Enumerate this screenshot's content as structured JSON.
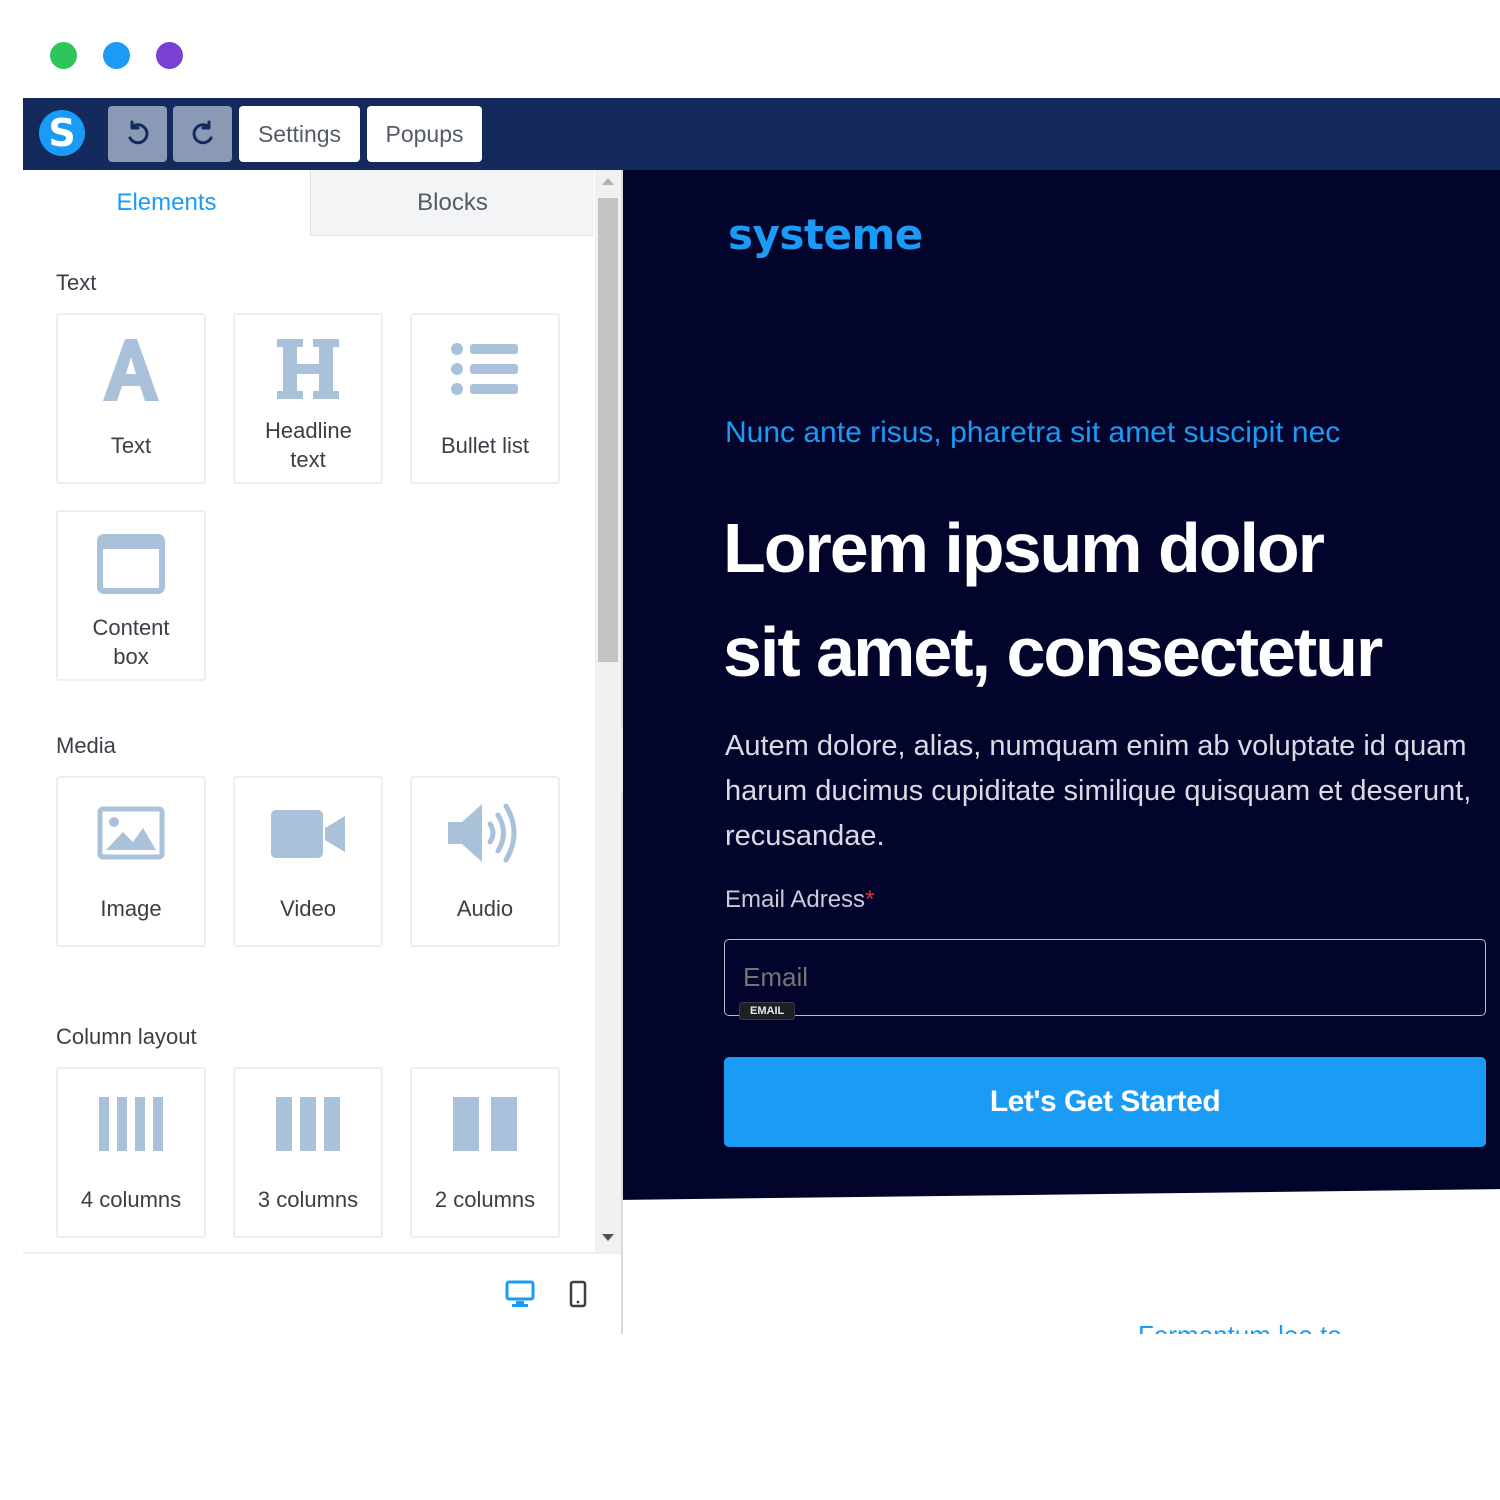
{
  "window_dots": [
    {
      "name": "green-dot",
      "color": "#2ec55a"
    },
    {
      "name": "blue-dot",
      "color": "#1a9bf6"
    },
    {
      "name": "purple-dot",
      "color": "#7a40d2"
    }
  ],
  "toolbar": {
    "logo_letter": "S",
    "undo_icon": "undo-icon",
    "redo_icon": "redo-icon",
    "settings_label": "Settings",
    "popups_label": "Popups"
  },
  "sidebar": {
    "tabs": [
      {
        "label": "Elements",
        "active": true
      },
      {
        "label": "Blocks",
        "active": false
      }
    ],
    "sections": {
      "text": {
        "label": "Text",
        "items": [
          {
            "label": "Text",
            "icon": "text-icon"
          },
          {
            "label": "Headline text",
            "icon": "headline-icon"
          },
          {
            "label": "Bullet list",
            "icon": "bullet-list-icon"
          },
          {
            "label": "Content box",
            "icon": "content-box-icon"
          }
        ]
      },
      "media": {
        "label": "Media",
        "items": [
          {
            "label": "Image",
            "icon": "image-icon"
          },
          {
            "label": "Video",
            "icon": "video-icon"
          },
          {
            "label": "Audio",
            "icon": "audio-icon"
          }
        ]
      },
      "columns": {
        "label": "Column layout",
        "items": [
          {
            "label": "4 columns",
            "icon": "four-columns-icon"
          },
          {
            "label": "3 columns",
            "icon": "three-columns-icon"
          },
          {
            "label": "2 columns",
            "icon": "two-columns-icon"
          }
        ]
      }
    },
    "view_modes": [
      {
        "icon": "desktop-icon",
        "active": true
      },
      {
        "icon": "mobile-icon",
        "active": false
      }
    ]
  },
  "page": {
    "brand": "systeme",
    "subheadline": "Nunc ante risus, pharetra sit amet suscipit nec",
    "headline_line1": "Lorem ipsum dolor",
    "headline_line2": "sit amet, consectetur",
    "paragraph": "Autem dolore, alias, numquam enim ab voluptate id quam harum ducimus cupiditate similique quisquam et deserunt, recusandae.",
    "email_label": "Email Adress",
    "email_required_mark": "*",
    "email_placeholder": "Email",
    "email_tag": "EMAIL",
    "cta_label": "Let's Get Started",
    "below_fold_text": "Fermentum leo te"
  },
  "colors": {
    "accent": "#1a9bf6",
    "topbar": "#142a5c",
    "hero_background": "#02042b",
    "icon_gray": "#a9c1d9",
    "required": "#e0303a"
  }
}
